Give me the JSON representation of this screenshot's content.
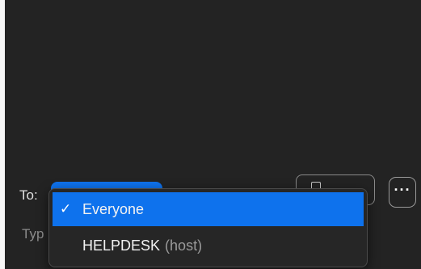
{
  "window": {
    "background": "#222222",
    "left_border_color": "#f7f7f7"
  },
  "chat_input": {
    "to_label": "To:",
    "placeholder_visible": "Typ",
    "recipient_select": {
      "selected_value": "Everyone",
      "color": "#0e72ed"
    },
    "file_button_icon": "file-icon",
    "more_button": {
      "label": "···",
      "icon": "more-options-icon"
    }
  },
  "dropdown": {
    "items": [
      {
        "check": "✓",
        "label": "Everyone",
        "role": "",
        "selected": true
      },
      {
        "check": "",
        "label": "HELPDESK",
        "role": "(host)",
        "selected": false
      }
    ],
    "highlight_color": "#0e72ed"
  }
}
